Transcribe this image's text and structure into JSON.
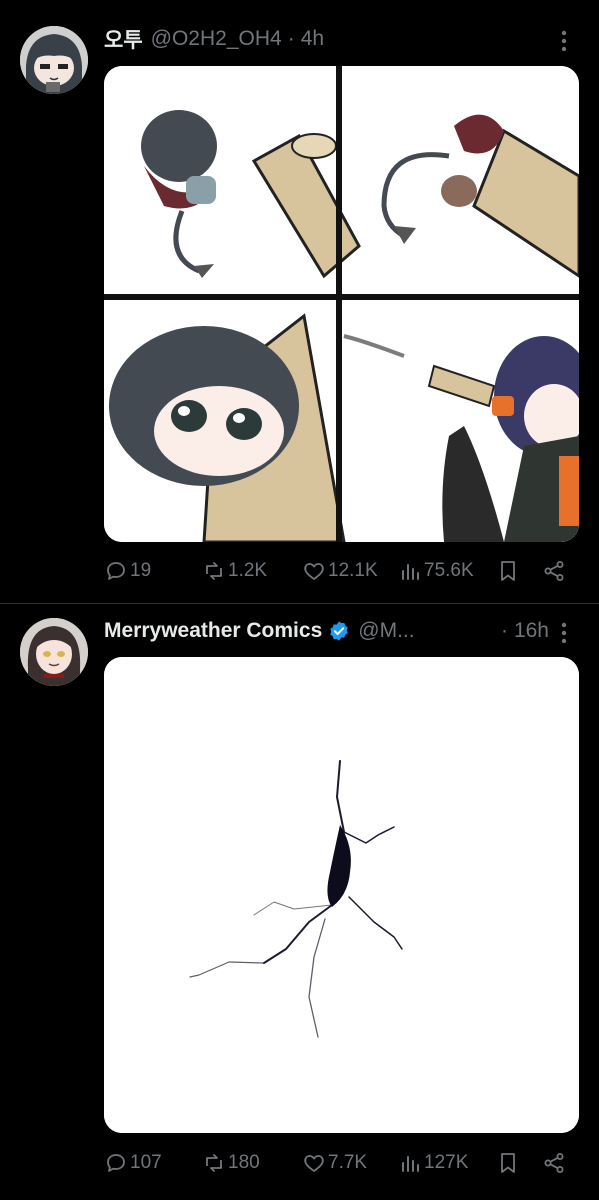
{
  "tweets": [
    {
      "author_name": "오투",
      "handle": "@O2H2_OH4",
      "separator": "·",
      "time": "4h",
      "verified": false,
      "stats": {
        "replies": "19",
        "reposts": "1.2K",
        "likes": "12.1K",
        "views": "75.6K"
      }
    },
    {
      "author_name": "Merryweather Comics",
      "handle": "@M...",
      "separator": "·",
      "time": "16h",
      "verified": true,
      "stats": {
        "replies": "107",
        "reposts": "180",
        "likes": "7.7K",
        "views": "127K"
      }
    }
  ],
  "colors": {
    "background": "#000000",
    "text": "#e7e9ea",
    "muted": "#71767b",
    "divider": "#2f3336",
    "verified_badge": "#1d9bf0"
  },
  "icons": [
    "more-icon",
    "reply-icon",
    "repost-icon",
    "like-icon",
    "views-icon",
    "bookmark-icon",
    "share-icon",
    "verified-icon"
  ]
}
